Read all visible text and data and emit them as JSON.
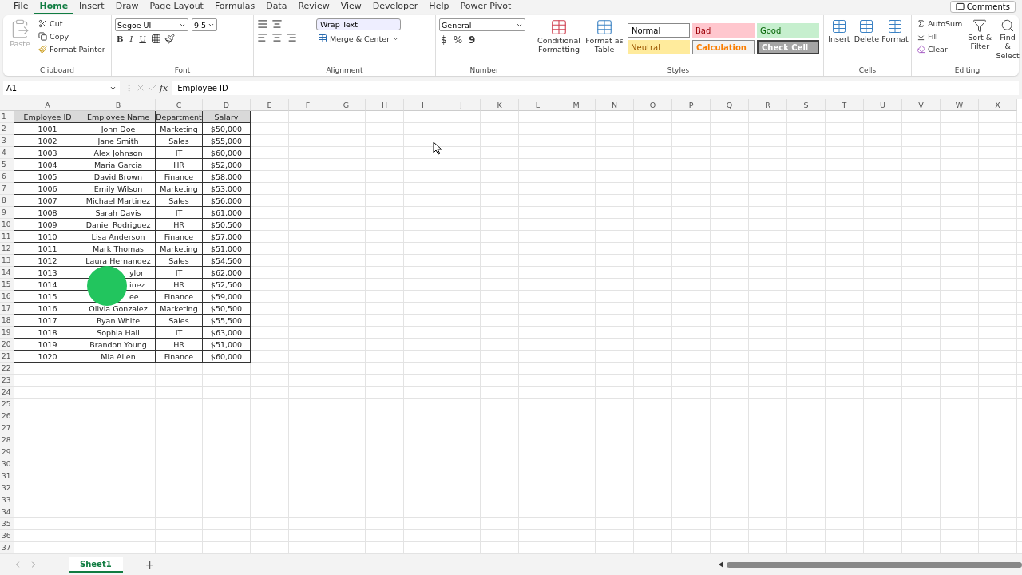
{
  "menu_tabs": [
    {
      "label": "File",
      "selected": false
    },
    {
      "label": "Home",
      "selected": true
    },
    {
      "label": "Insert",
      "selected": false
    },
    {
      "label": "Draw",
      "selected": false
    },
    {
      "label": "Page Layout",
      "selected": false
    },
    {
      "label": "Formulas",
      "selected": false
    },
    {
      "label": "Data",
      "selected": false
    },
    {
      "label": "Review",
      "selected": false
    },
    {
      "label": "View",
      "selected": false
    },
    {
      "label": "Developer",
      "selected": false
    },
    {
      "label": "Help",
      "selected": false
    },
    {
      "label": "Power Pivot",
      "selected": false
    }
  ],
  "comments_button": "Comments",
  "clipboard": {
    "paste": {
      "label": "Paste",
      "disabled": true
    },
    "cut": "Cut",
    "copy": "Copy",
    "format_painter": "Format Painter",
    "label": "Clipboard"
  },
  "font": {
    "font_name": "Segoe UI",
    "font_size": "9.5",
    "bold": "B",
    "italic": "I",
    "underline": "U",
    "label": "Font"
  },
  "alignment": {
    "wrap_text": "Wrap Text",
    "merge_center": "Merge & Center",
    "label": "Alignment"
  },
  "number": {
    "format": "General",
    "currency": "$",
    "percent": "%",
    "comma": "9",
    "label": "Number"
  },
  "styles": {
    "conditional_formatting": "Conditional Formatting",
    "format_as_table": "Format as Table",
    "label": "Styles",
    "cell_styles": [
      {
        "label": "Normal",
        "kind": "normal"
      },
      {
        "label": "Bad",
        "kind": "bad"
      },
      {
        "label": "Good",
        "kind": "good"
      },
      {
        "label": "Neutral",
        "kind": "neutral"
      },
      {
        "label": "Calculation",
        "kind": "calculation"
      },
      {
        "label": "Check Cell",
        "kind": "check"
      }
    ]
  },
  "cells_group": {
    "buttons": [
      "Insert",
      "Delete",
      "Format"
    ],
    "label": "Cells"
  },
  "editing": {
    "autosum": "AutoSum",
    "fill": "Fill",
    "clear": "Clear",
    "sort_filter": "Sort & Filter",
    "find_select": "Find & Select",
    "label": "Editing"
  },
  "formula_bar": {
    "name_box": "A1",
    "function_label": "fx",
    "value": "Employee ID"
  },
  "sheet": {
    "columns": [
      "A",
      "B",
      "C",
      "D",
      "E",
      "F",
      "G",
      "H",
      "I",
      "J",
      "K",
      "L",
      "M",
      "N",
      "O",
      "P",
      "Q",
      "R",
      "S",
      "T",
      "U",
      "V",
      "W",
      "X"
    ],
    "row_numbers": [
      "1",
      "2",
      "3",
      "4",
      "5",
      "6",
      "7",
      "8",
      "9",
      "10",
      "11",
      "12",
      "13",
      "14",
      "15",
      "16",
      "17",
      "18",
      "19",
      "20",
      "21",
      "22",
      "23",
      "24",
      "25",
      "26",
      "27",
      "28",
      "29",
      "30",
      "31",
      "32",
      "33",
      "34",
      "35",
      "36",
      "37"
    ],
    "table": [
      {
        "kind": "header",
        "cells": [
          "Employee ID",
          "Employee Name",
          "Department",
          "Salary"
        ]
      },
      {
        "kind": "full",
        "cells": [
          "1001",
          "John Doe",
          "Marketing",
          "$50,000"
        ]
      },
      {
        "kind": "full",
        "cells": [
          "1002",
          "Jane Smith",
          "Sales",
          "$55,000"
        ]
      },
      {
        "kind": "full",
        "cells": [
          "1003",
          "Alex Johnson",
          "IT",
          "$60,000"
        ]
      },
      {
        "kind": "full",
        "cells": [
          "1004",
          "Maria Garcia",
          "HR",
          "$52,000"
        ]
      },
      {
        "kind": "full",
        "cells": [
          "1005",
          "David Brown",
          "Finance",
          "$58,000"
        ]
      },
      {
        "kind": "full",
        "cells": [
          "1006",
          "Emily Wilson",
          "Marketing",
          "$53,000"
        ]
      },
      {
        "kind": "full",
        "cells": [
          "1007",
          "Michael Martinez",
          "Sales",
          "$56,000"
        ]
      },
      {
        "kind": "full",
        "cells": [
          "1008",
          "Sarah Davis",
          "IT",
          "$61,000"
        ]
      },
      {
        "kind": "full",
        "cells": [
          "1009",
          "Daniel Rodriguez",
          "HR",
          "$50,500"
        ]
      },
      {
        "kind": "full",
        "cells": [
          "1010",
          "Lisa Anderson",
          "Finance",
          "$57,000"
        ]
      },
      {
        "kind": "full",
        "cells": [
          "1011",
          "Mark Thomas",
          "Marketing",
          "$51,000"
        ]
      },
      {
        "kind": "full",
        "cells": [
          "1012",
          "Laura Hernandez",
          "Sales",
          "$54,500"
        ]
      },
      {
        "kind": "partial",
        "cells": [
          "1013",
          "ylor",
          "IT",
          "$62,000"
        ]
      },
      {
        "kind": "partial",
        "cells": [
          "1014",
          "inez",
          "HR",
          "$52,500"
        ]
      },
      {
        "kind": "partial",
        "cells": [
          "1015",
          "ee",
          "Finance",
          "$59,000"
        ]
      },
      {
        "kind": "full",
        "cells": [
          "1016",
          "Olivia Gonzalez",
          "Marketing",
          "$50,500"
        ]
      },
      {
        "kind": "full",
        "cells": [
          "1017",
          "Ryan White",
          "Sales",
          "$55,500"
        ]
      },
      {
        "kind": "full",
        "cells": [
          "1018",
          "Sophia Hall",
          "IT",
          "$63,000"
        ]
      },
      {
        "kind": "full",
        "cells": [
          "1019",
          "Brandon Young",
          "HR",
          "$51,000"
        ]
      },
      {
        "kind": "full",
        "cells": [
          "1020",
          "Mia Allen",
          "Finance",
          "$60,000"
        ]
      }
    ]
  },
  "sheet_tabs": [
    {
      "label": "Sheet1",
      "selected": true
    }
  ],
  "add_sheet": "+"
}
